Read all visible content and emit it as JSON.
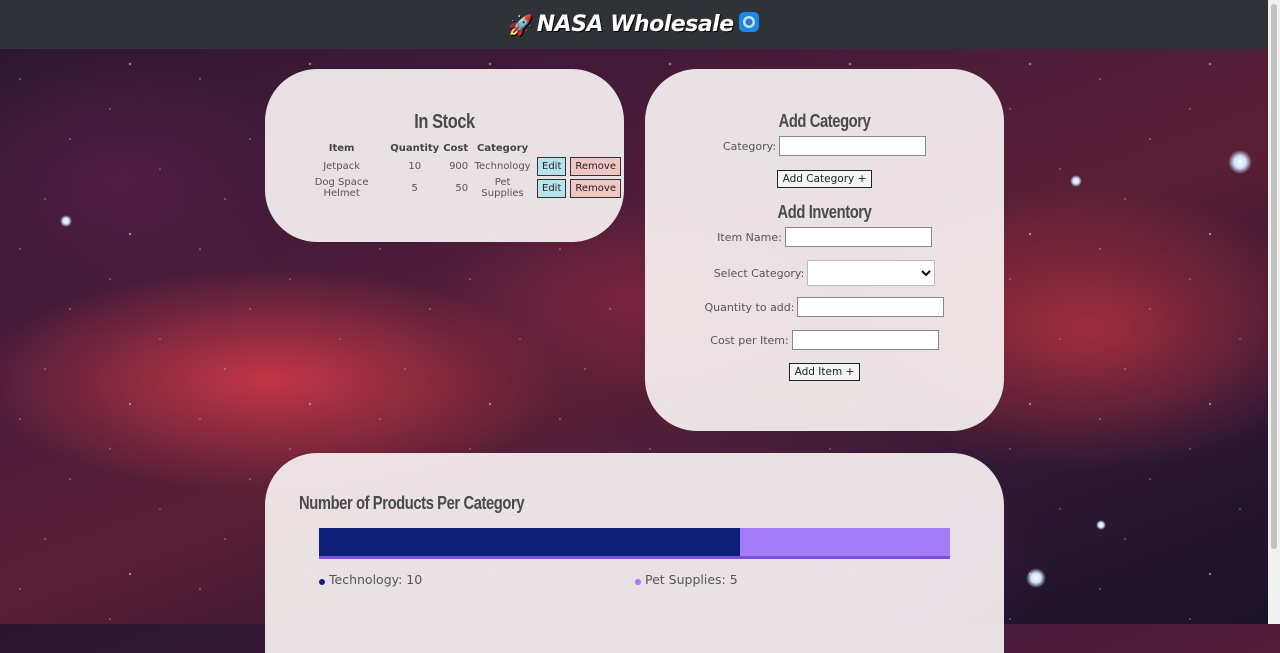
{
  "header": {
    "title": "NASA Wholesale",
    "left_icon": "rocket-icon",
    "right_icon": "planet-icon"
  },
  "stock": {
    "title": "In Stock",
    "columns": [
      "Item",
      "Quantity",
      "Cost",
      "Category"
    ],
    "rows": [
      {
        "item": "Jetpack",
        "quantity": "10",
        "cost": "900",
        "category": "Technology",
        "edit": "Edit",
        "remove": "Remove"
      },
      {
        "item": "Dog Space Helmet",
        "quantity": "5",
        "cost": "50",
        "category": "Pet Supplies",
        "edit": "Edit",
        "remove": "Remove"
      }
    ]
  },
  "add_category": {
    "title": "Add Category",
    "category_label": "Category:",
    "category_value": "",
    "button": "Add Category +"
  },
  "add_inventory": {
    "title": "Add Inventory",
    "item_name_label": "Item Name:",
    "item_name_value": "",
    "select_category_label": "Select Category:",
    "select_category_value": "",
    "quantity_label": "Quantity to add:",
    "quantity_value": "",
    "cost_label": "Cost per Item:",
    "cost_value": "",
    "button": "Add Item +"
  },
  "chart": {
    "title": "Number of Products Per Category",
    "legend": [
      {
        "label": "Technology: 10",
        "color": "#0e1f7a"
      },
      {
        "label": "Pet Supplies: 5",
        "color": "#a57cf7"
      }
    ]
  },
  "chart_data": {
    "type": "bar",
    "title": "Number of Products Per Category",
    "categories": [
      "Technology",
      "Pet Supplies"
    ],
    "values": [
      10,
      5
    ],
    "colors": [
      "#0e1f7a",
      "#a57cf7"
    ],
    "stacked": true,
    "orientation": "horizontal",
    "legend": "bottom"
  }
}
